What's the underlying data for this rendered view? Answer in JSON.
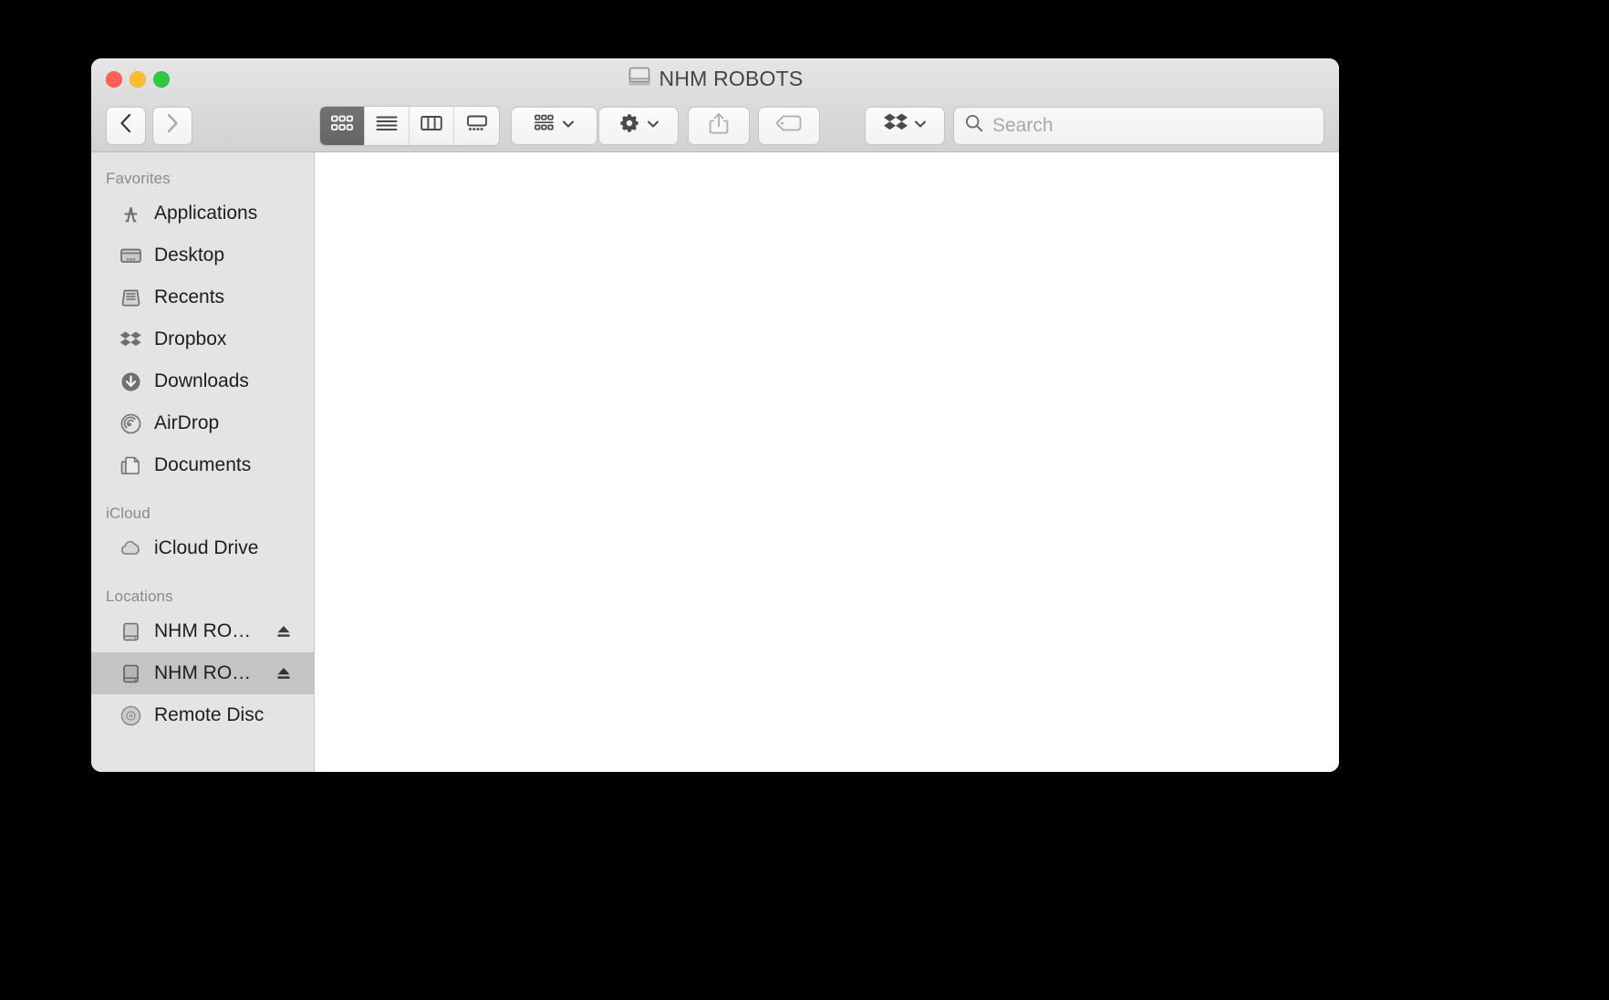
{
  "window": {
    "title": "NHM ROBOTS",
    "title_icon": "external-drive-icon",
    "traffic_lights": {
      "close": "close-window-button",
      "minimize": "minimize-window-button",
      "zoom": "maximize-window-button"
    },
    "colors": {
      "close": "#ff5f57",
      "minimize": "#febc2e",
      "zoom": "#2fc840",
      "titlebar": "#e0e0e0",
      "toolbar": "#d6d6d6",
      "sidebar": "#e4e4e4",
      "content": "#ffffff",
      "selection": "#c4c4c4",
      "active_view_button": "#6b6b6b"
    }
  },
  "toolbar": {
    "back_label": "Back",
    "forward_label": "Forward",
    "view_buttons": [
      {
        "name": "icon-view",
        "label": "Icon View",
        "active": true
      },
      {
        "name": "list-view",
        "label": "List View",
        "active": false
      },
      {
        "name": "column-view",
        "label": "Column View",
        "active": false
      },
      {
        "name": "gallery-view",
        "label": "Gallery View",
        "active": false
      }
    ],
    "arrange_label": "Arrange",
    "action_label": "Action",
    "share_label": "Share",
    "tags_label": "Tags",
    "dropbox_label": "Dropbox"
  },
  "search": {
    "placeholder": "Search",
    "value": ""
  },
  "sidebar": {
    "sections": [
      {
        "title": "Favorites",
        "items": [
          {
            "label": "Applications",
            "icon": "applications-icon",
            "eject": false,
            "selected": false
          },
          {
            "label": "Desktop",
            "icon": "desktop-icon",
            "eject": false,
            "selected": false
          },
          {
            "label": "Recents",
            "icon": "recents-icon",
            "eject": false,
            "selected": false
          },
          {
            "label": "Dropbox",
            "icon": "dropbox-icon",
            "eject": false,
            "selected": false
          },
          {
            "label": "Downloads",
            "icon": "downloads-icon",
            "eject": false,
            "selected": false
          },
          {
            "label": "AirDrop",
            "icon": "airdrop-icon",
            "eject": false,
            "selected": false
          },
          {
            "label": "Documents",
            "icon": "documents-icon",
            "eject": false,
            "selected": false
          }
        ]
      },
      {
        "title": "iCloud",
        "items": [
          {
            "label": "iCloud Drive",
            "icon": "icloud-icon",
            "eject": false,
            "selected": false
          }
        ]
      },
      {
        "title": "Locations",
        "items": [
          {
            "label": "NHM RO…",
            "icon": "external-drive-icon",
            "eject": true,
            "selected": false
          },
          {
            "label": "NHM RO…",
            "icon": "external-drive-icon",
            "eject": true,
            "selected": true
          },
          {
            "label": "Remote Disc",
            "icon": "optical-disc-icon",
            "eject": false,
            "selected": false
          }
        ]
      }
    ]
  },
  "content": {
    "empty": true,
    "items": []
  }
}
